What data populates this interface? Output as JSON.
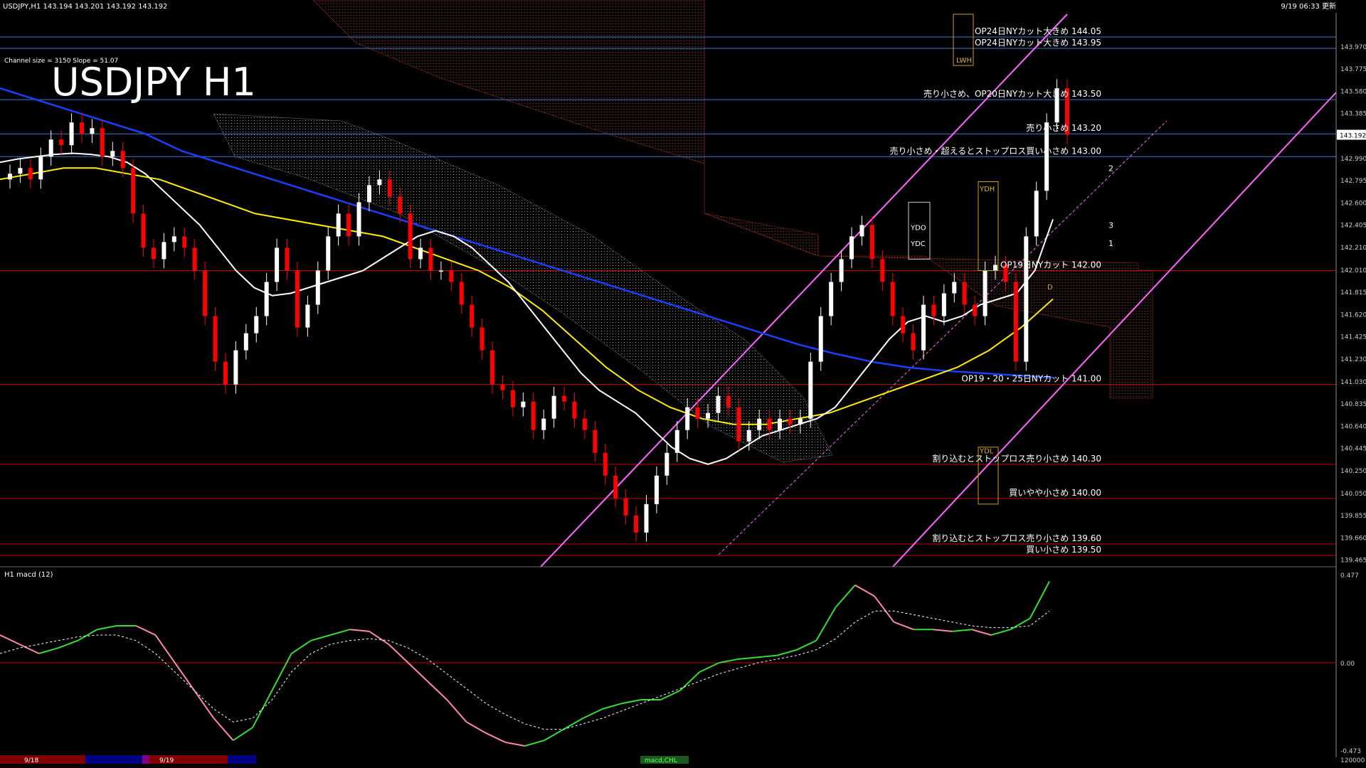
{
  "header": {
    "symbol_line": "USDJPY,H1  143.194 143.201 143.192 143.192",
    "datetime": "9/19 06:33 更新",
    "channel_info": "Channel size = 3150 Slope = 51.07",
    "big_title": "USDJPY H1"
  },
  "colors": {
    "background": "#000000",
    "bull_candle": "#ffffff",
    "bear_candle": "#ff0000",
    "price_axis_text": "#cccccc",
    "level_red": "#cc0000",
    "level_blue": "#3a7bd5",
    "channel_pink": "#ff66ff",
    "sma_white": "#ffffff",
    "sma_yellow": "#ffee00",
    "sma_blue": "#1a3fff",
    "kumo_red": "#b33020",
    "kumo_white": "#bbbbbb",
    "chikou_green": "#22cc22",
    "macd_pos": "#33dd33",
    "macd_neg": "#ff88aa",
    "macd_signal": "#ffffff"
  },
  "chart_data": [
    {
      "type": "line",
      "name": "price-panel",
      "title": "USDJPY H1",
      "ylim": [
        139.4,
        144.25
      ],
      "price_ticks": [
        139.465,
        139.66,
        139.855,
        140.05,
        140.25,
        140.445,
        140.64,
        140.835,
        141.03,
        141.23,
        141.425,
        141.62,
        141.815,
        142.01,
        142.21,
        142.405,
        142.6,
        142.795,
        142.99,
        143.192,
        143.385,
        143.58,
        143.775,
        143.97
      ],
      "price_tick_labels": [
        "139.465",
        "139.660",
        "139.855",
        "140.050",
        "140.250",
        "140.445",
        "140.640",
        "140.835",
        "141.030",
        "141.230",
        "141.425",
        "141.620",
        "141.815",
        "142.010",
        "142.210",
        "142.405",
        "142.600",
        "142.795",
        "142.990",
        "143.192",
        "143.385",
        "143.580",
        "143.775",
        "143.970"
      ],
      "current_price": 143.192,
      "current_price_label": "143.192",
      "levels": [
        {
          "price": 144.05,
          "color": "blue",
          "text": "OP24日NYカット大きめ 144.05"
        },
        {
          "price": 143.95,
          "color": "blue",
          "text": "OP24日NYカット大きめ 143.95"
        },
        {
          "price": 143.5,
          "color": "blue",
          "text": "売り小さめ、OP20日NYカット大きめ 143.50"
        },
        {
          "price": 143.2,
          "color": "blue",
          "text": "売り小さめ 143.20"
        },
        {
          "price": 143.0,
          "color": "blue",
          "text": "売り小さめ・超えるとストップロス買い小さめ 143.00"
        },
        {
          "price": 142.0,
          "color": "red",
          "text": "OP19日NYカット 142.00"
        },
        {
          "price": 141.0,
          "color": "red",
          "text": "OP19・20・25日NYカット 141.00"
        },
        {
          "price": 140.3,
          "color": "red",
          "text": "割り込むとストップロス売り小さめ 140.30"
        },
        {
          "price": 140.0,
          "color": "red",
          "text": "買いやや小さめ 140.00"
        },
        {
          "price": 139.6,
          "color": "red",
          "text": "割り込むとストップロス売り小さめ 139.60"
        },
        {
          "price": 139.5,
          "color": "red",
          "text": "買い小さめ 139.50"
        }
      ],
      "box_labels": [
        {
          "text": "LWH",
          "price": 143.85
        },
        {
          "text": "YDH",
          "price": 142.72
        },
        {
          "text": "YDO",
          "price": 142.38
        },
        {
          "text": "YDC",
          "price": 142.24
        },
        {
          "text": "YDL",
          "price": 140.42
        },
        {
          "text": "D",
          "price": 141.86
        }
      ],
      "fib_labels": [
        "2",
        "3",
        "1"
      ],
      "closes": [
        142.85,
        142.9,
        142.8,
        143.0,
        143.15,
        143.1,
        143.3,
        143.2,
        143.25,
        143.0,
        143.05,
        142.9,
        142.5,
        142.2,
        142.1,
        142.25,
        142.3,
        142.2,
        142.0,
        141.6,
        141.2,
        141.0,
        141.3,
        141.45,
        141.6,
        141.9,
        142.2,
        142.0,
        141.5,
        141.7,
        142.0,
        142.3,
        142.5,
        142.3,
        142.6,
        142.75,
        142.8,
        142.65,
        142.5,
        142.1,
        142.2,
        142.0,
        142.0,
        141.9,
        141.7,
        141.5,
        141.3,
        141.0,
        140.95,
        140.8,
        140.85,
        140.6,
        140.7,
        140.9,
        140.85,
        140.7,
        140.6,
        140.4,
        140.2,
        140.0,
        139.85,
        139.7,
        139.95,
        140.2,
        140.4,
        140.6,
        140.8,
        140.7,
        140.75,
        140.9,
        140.8,
        140.5,
        140.6,
        140.7,
        140.6,
        140.7,
        140.65,
        140.7,
        141.2,
        141.6,
        141.9,
        142.1,
        142.3,
        142.4,
        142.1,
        141.9,
        141.6,
        141.45,
        141.3,
        141.7,
        141.6,
        141.8,
        141.9,
        141.7,
        141.6,
        142.0,
        142.05,
        141.9,
        141.2,
        142.3,
        142.7,
        143.3,
        143.6,
        143.192
      ],
      "sma_white": [
        142.95,
        142.98,
        143.0,
        143.02,
        143.03,
        143.02,
        143.0,
        142.95,
        142.85,
        142.7,
        142.55,
        142.4,
        142.2,
        142.0,
        141.85,
        141.78,
        141.8,
        141.85,
        141.9,
        141.95,
        142.0,
        142.1,
        142.2,
        142.3,
        142.35,
        142.3,
        142.2,
        142.05,
        141.9,
        141.7,
        141.5,
        141.3,
        141.1,
        140.95,
        140.85,
        140.75,
        140.6,
        140.45,
        140.35,
        140.3,
        140.35,
        140.45,
        140.55,
        140.6,
        140.65,
        140.7,
        140.8,
        141.0,
        141.2,
        141.4,
        141.55,
        141.6,
        141.55,
        141.6,
        141.7,
        141.75,
        141.8,
        142.0,
        142.45
      ],
      "sma_yellow": [
        142.8,
        142.85,
        142.9,
        142.9,
        142.85,
        142.8,
        142.7,
        142.6,
        142.5,
        142.45,
        142.4,
        142.35,
        142.3,
        142.2,
        142.1,
        142.0,
        141.85,
        141.65,
        141.4,
        141.15,
        140.95,
        140.8,
        140.7,
        140.65,
        140.65,
        140.7,
        140.75,
        140.85,
        140.95,
        141.05,
        141.15,
        141.3,
        141.5,
        141.75
      ],
      "sma_blue": [
        143.6,
        143.5,
        143.4,
        143.3,
        143.2,
        143.05,
        142.95,
        142.85,
        142.75,
        142.65,
        142.55,
        142.45,
        142.35,
        142.25,
        142.15,
        142.05,
        141.95,
        141.85,
        141.75,
        141.65,
        141.55,
        141.45,
        141.35,
        141.27,
        141.2,
        141.15,
        141.12,
        141.1,
        141.08,
        141.06
      ],
      "macd": {
        "name": "H1  macd (12)",
        "ylim": [
          -0.473,
          0.477
        ],
        "tick_labels": [
          "0.477",
          "0.00",
          "-0.473"
        ],
        "values": [
          0.15,
          0.1,
          0.05,
          0.08,
          0.12,
          0.18,
          0.2,
          0.2,
          0.15,
          0.0,
          -0.15,
          -0.3,
          -0.42,
          -0.35,
          -0.15,
          0.05,
          0.12,
          0.15,
          0.18,
          0.17,
          0.1,
          0.0,
          -0.1,
          -0.2,
          -0.32,
          -0.38,
          -0.43,
          -0.45,
          -0.42,
          -0.36,
          -0.3,
          -0.25,
          -0.22,
          -0.2,
          -0.2,
          -0.15,
          -0.05,
          0.0,
          0.02,
          0.03,
          0.04,
          0.07,
          0.12,
          0.3,
          0.42,
          0.36,
          0.22,
          0.18,
          0.18,
          0.17,
          0.18,
          0.15,
          0.18,
          0.24,
          0.44
        ],
        "signal": [
          0.05,
          0.08,
          0.1,
          0.12,
          0.14,
          0.15,
          0.15,
          0.12,
          0.05,
          -0.05,
          -0.15,
          -0.25,
          -0.32,
          -0.3,
          -0.2,
          -0.05,
          0.05,
          0.1,
          0.12,
          0.13,
          0.12,
          0.08,
          0.02,
          -0.06,
          -0.14,
          -0.22,
          -0.28,
          -0.33,
          -0.36,
          -0.36,
          -0.33,
          -0.3,
          -0.26,
          -0.22,
          -0.18,
          -0.14,
          -0.1,
          -0.06,
          -0.03,
          0.0,
          0.02,
          0.04,
          0.07,
          0.13,
          0.22,
          0.28,
          0.28,
          0.26,
          0.24,
          0.22,
          0.2,
          0.19,
          0.19,
          0.2,
          0.28
        ]
      }
    }
  ],
  "footer": {
    "dates": [
      "9/18",
      "9/19"
    ],
    "bottom_right": "120000",
    "tab_label": "macd,CHL"
  }
}
